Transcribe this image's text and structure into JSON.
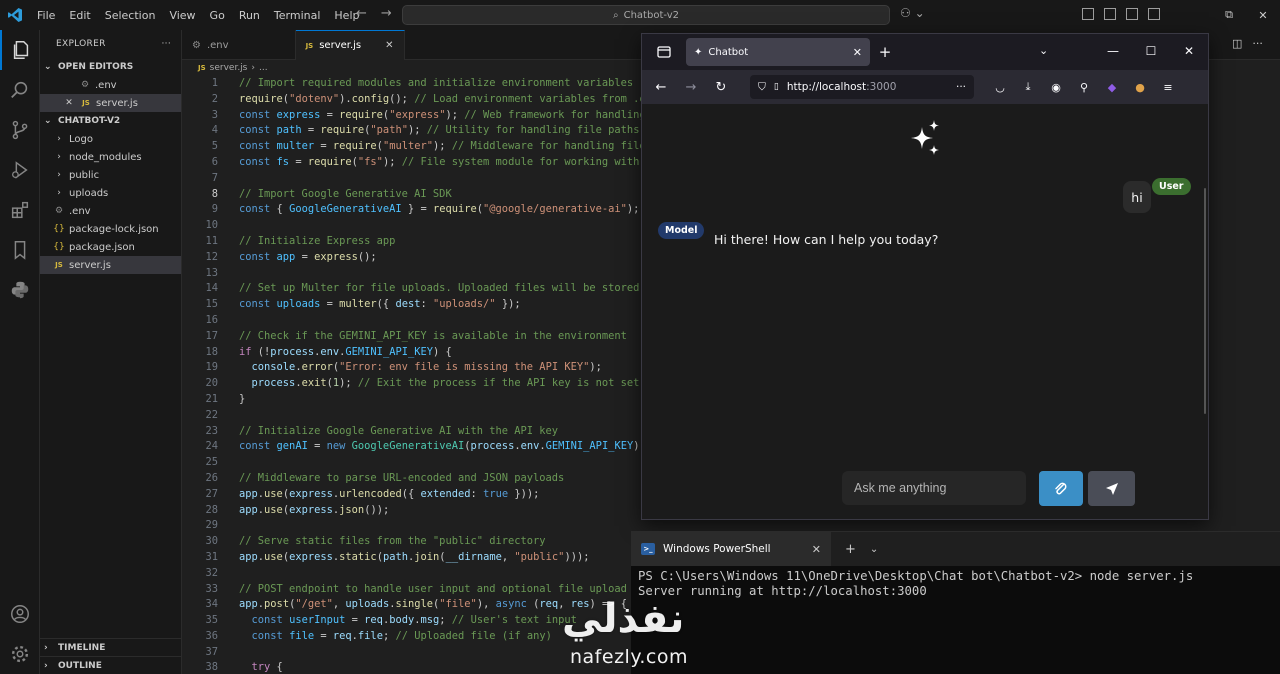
{
  "titlebar": {
    "menu": [
      "File",
      "Edit",
      "Selection",
      "View",
      "Go",
      "Run",
      "Terminal",
      "Help"
    ],
    "search": "Chatbot-v2"
  },
  "sidebar": {
    "title": "EXPLORER",
    "open_editors_title": "OPEN EDITORS",
    "open_editors": [
      ".env",
      "server.js"
    ],
    "project_title": "CHATBOT-V2",
    "tree": [
      "Logo",
      "node_modules",
      "public",
      "uploads",
      ".env",
      "package-lock.json",
      "package.json",
      "server.js"
    ],
    "timeline": "TIMELINE",
    "outline": "OUTLINE"
  },
  "editor": {
    "tabs": [
      ".env",
      "server.js"
    ],
    "breadcrumb_file": "server.js",
    "breadcrumb_more": "...",
    "line_numbers": [
      "1",
      "2",
      "3",
      "4",
      "5",
      "6",
      "7",
      "8",
      "9",
      "10",
      "11",
      "12",
      "13",
      "14",
      "15",
      "16",
      "17",
      "18",
      "19",
      "20",
      "21",
      "22",
      "23",
      "24",
      "25",
      "26",
      "27",
      "28",
      "29",
      "30",
      "31",
      "32",
      "33",
      "34",
      "35",
      "36",
      "37",
      "38"
    ]
  },
  "browser": {
    "tab_title": "Chatbot",
    "url_host": "http://localhost",
    "url_port": ":3000",
    "messages": {
      "user_badge": "User",
      "user_text": "hi",
      "model_badge": "Model",
      "model_text": "Hi there! How can I help you today?"
    },
    "composer_placeholder": "Ask me anything"
  },
  "terminal": {
    "tab_title": "Windows PowerShell",
    "line1": "PS C:\\Users\\Windows 11\\OneDrive\\Desktop\\Chat bot\\Chatbot-v2> node server.js",
    "line2": "Server running at http://localhost:3000"
  },
  "watermark": {
    "arabic": "نفذلي",
    "latin": "nafezly.com"
  }
}
